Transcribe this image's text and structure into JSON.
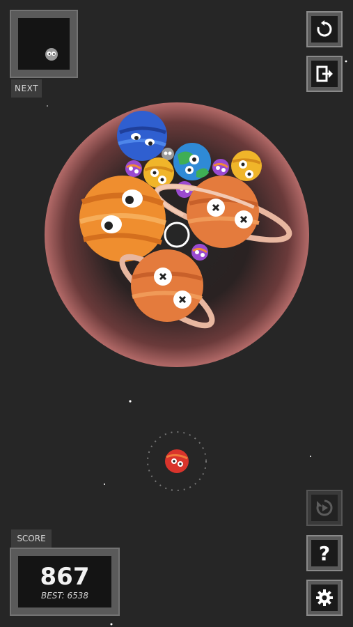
{
  "next_panel": {
    "label": "NEXT",
    "next_item_icon": "small-gray-planet-icon"
  },
  "buttons": {
    "restart_icon": "restart-icon",
    "exit_icon": "exit-icon",
    "undo_icon": "rewind-icon",
    "help_label": "?",
    "settings_icon": "gear-icon"
  },
  "score": {
    "label": "SCORE",
    "value": "867",
    "best": "BEST: 6538"
  },
  "colors": {
    "background": "#262626",
    "panel": "#5a5a5a",
    "panel_inner": "#141414",
    "gravity_field": "#b36a68"
  },
  "planets": [
    {
      "icon": "saturn-orange-planet-icon"
    },
    {
      "icon": "jupiter-orange-planet-icon"
    },
    {
      "icon": "blue-planet-icon"
    },
    {
      "icon": "earth-planet-icon"
    },
    {
      "icon": "yellow-planet-icon"
    },
    {
      "icon": "purple-planet-icon"
    },
    {
      "icon": "red-planet-icon"
    }
  ]
}
